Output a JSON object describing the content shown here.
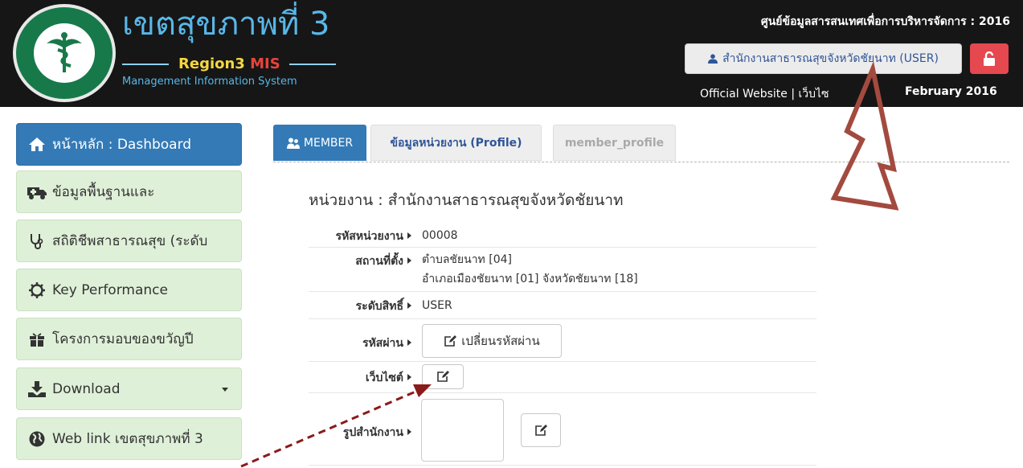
{
  "header": {
    "brand_title": "เขตสุขภาพที่ 3",
    "brand_region": "Region3 ",
    "brand_mis": "MIS",
    "brand_tagline": "Management Information System",
    "right_title": "ศูนย์ข้อมูลสารสนเทศเพื่อการบริหารจัดการ : 2016",
    "user_button": "สำนักงานสาธารณสุขจังหวัดชัยนาท (USER)",
    "links_text": "Official Website | เว็บไซ",
    "date_text": "February 2016",
    "logout_color": "#e5484f"
  },
  "sidebar": {
    "items": [
      {
        "label": "หน้าหลัก : Dashboard",
        "icon": "home-icon",
        "active": true
      },
      {
        "label": "ข้อมูลพื้นฐานและ",
        "icon": "ambulance-icon"
      },
      {
        "label": "สถิติชีพสาธารณสุข (ระดับ",
        "icon": "stethoscope-icon"
      },
      {
        "label": "Key Performance",
        "icon": "cog-icon"
      },
      {
        "label": "โครงการมอบของขวัญปี",
        "icon": "gift-icon"
      },
      {
        "label": "Download",
        "icon": "download-icon",
        "has_caret": true
      },
      {
        "label": "Web link เขตสุขภาพที่ 3",
        "icon": "globe-icon"
      }
    ]
  },
  "tabs": {
    "member": "MEMBER",
    "profile": "ข้อมูลหน่วยงาน (Profile)",
    "member_profile": "member_profile"
  },
  "profile": {
    "unit_title": "หน่วยงาน : สำนักงานสาธารณสุขจังหวัดชัยนาท",
    "code_label": "รหัสหน่วยงาน",
    "code_value": "00008",
    "location_label": "สถานที่ตั้ง",
    "location_line1": "ตำบลชัยนาท [04]",
    "location_line2": "อำเภอเมืองชัยนาท [01] จังหวัดชัยนาท [18]",
    "level_label": "ระดับสิทธิ์",
    "level_value": "USER",
    "password_label": "รหัสผ่าน",
    "change_password_button": "เปลี่ยนรหัสผ่าน",
    "website_label": "เว็บไซต์",
    "photo_label": "รูปสำนักงาน"
  }
}
